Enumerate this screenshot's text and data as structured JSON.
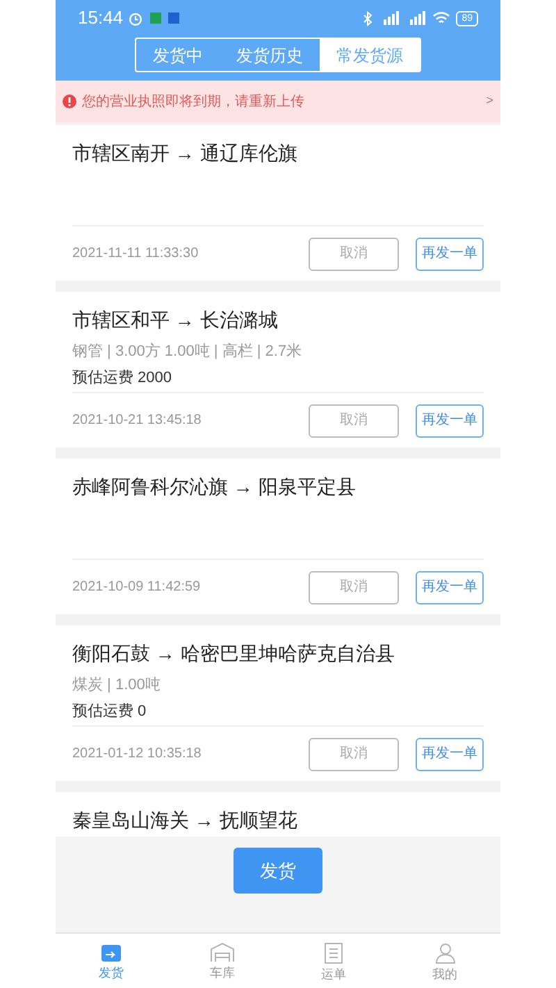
{
  "status_bar": {
    "time": "15:44",
    "battery": "89"
  },
  "tabs": [
    {
      "label": "发货中",
      "selected": false
    },
    {
      "label": "发货历史",
      "selected": false
    },
    {
      "label": "常发货源",
      "selected": true
    }
  ],
  "alert": {
    "text": "您的营业执照即将到期，请重新上传",
    "chevron": ">"
  },
  "orders": [
    {
      "route": "市辖区南开 → 通辽库伦旗",
      "time": "2021-11-11 11:33:30",
      "cancel": "取消",
      "reorder": "再发一单"
    },
    {
      "route": "市辖区和平 → 长治潞城",
      "specs": "钢管 | 3.00方 1.00吨 | 高栏 | 2.7米",
      "fee": "预估运费 2000",
      "time": "2021-10-21 13:45:18",
      "cancel": "取消",
      "reorder": "再发一单"
    },
    {
      "route": "赤峰阿鲁科尔沁旗 → 阳泉平定县",
      "time": "2021-10-09 11:42:59",
      "cancel": "取消",
      "reorder": "再发一单"
    },
    {
      "route": "衡阳石鼓 → 哈密巴里坤哈萨克自治县",
      "specs": "煤炭 | 1.00吨",
      "fee": "预估运费 0",
      "time": "2021-01-12 10:35:18",
      "cancel": "取消",
      "reorder": "再发一单"
    },
    {
      "route": "秦皇岛山海关 → 抚顺望花"
    }
  ],
  "ship_button": "发货",
  "nav": [
    {
      "label": "发货",
      "kind": "box",
      "selected": true
    },
    {
      "label": "车库",
      "kind": "garage",
      "selected": false
    },
    {
      "label": "运单",
      "kind": "doc",
      "selected": false
    },
    {
      "label": "我的",
      "kind": "person",
      "selected": false
    }
  ]
}
